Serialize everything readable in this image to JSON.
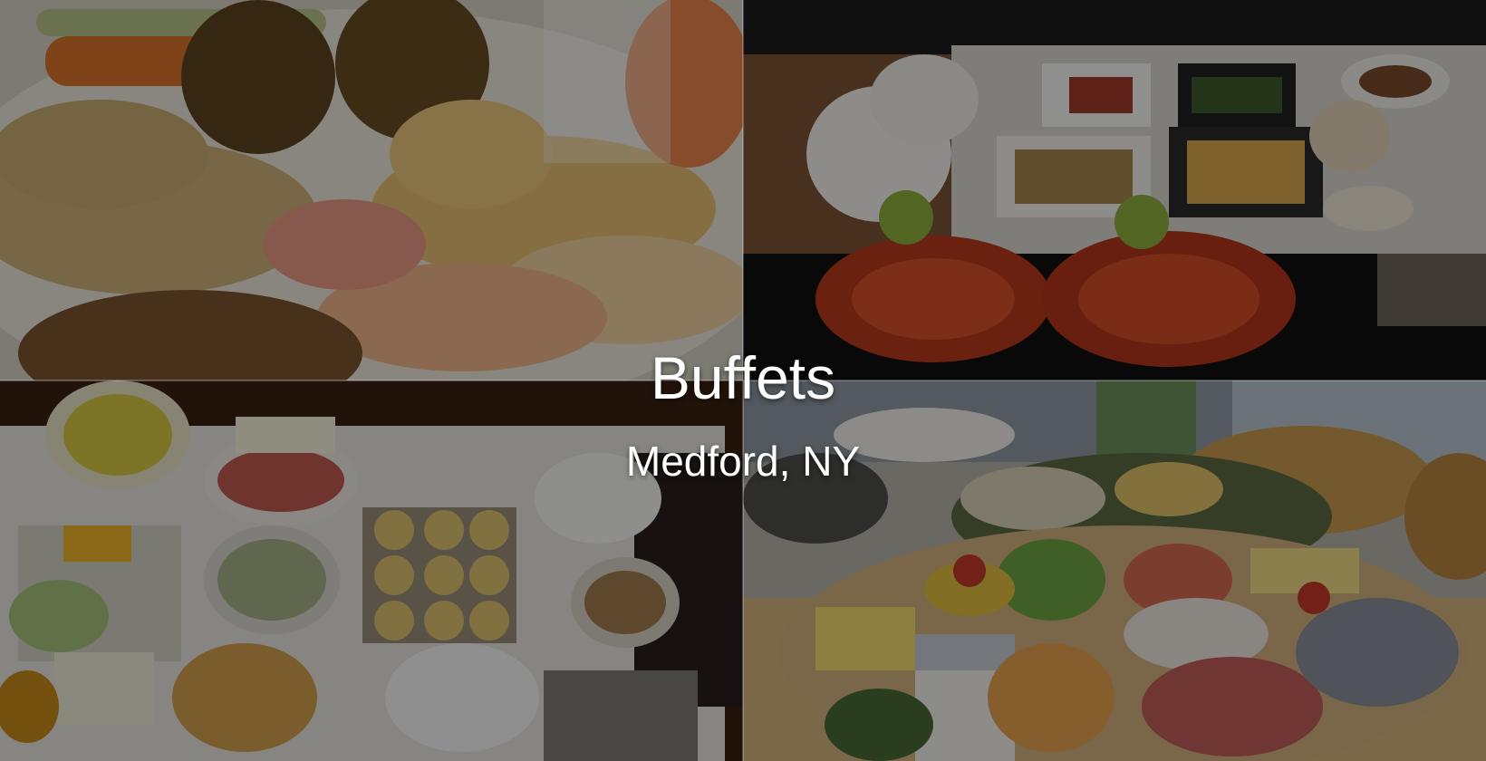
{
  "hero": {
    "title": "Buffets",
    "subtitle": "Medford, NY"
  },
  "tiles": [
    {
      "subject": "plate-of-fried-food-and-melon"
    },
    {
      "subject": "buffet-table-with-crayfish-and-salads"
    },
    {
      "subject": "breakfast-spread-with-muffins-and-croissants"
    },
    {
      "subject": "fruit-and-cheese-platter"
    }
  ],
  "colors": {
    "overlay": "#00000066",
    "text": "#ffffff"
  }
}
